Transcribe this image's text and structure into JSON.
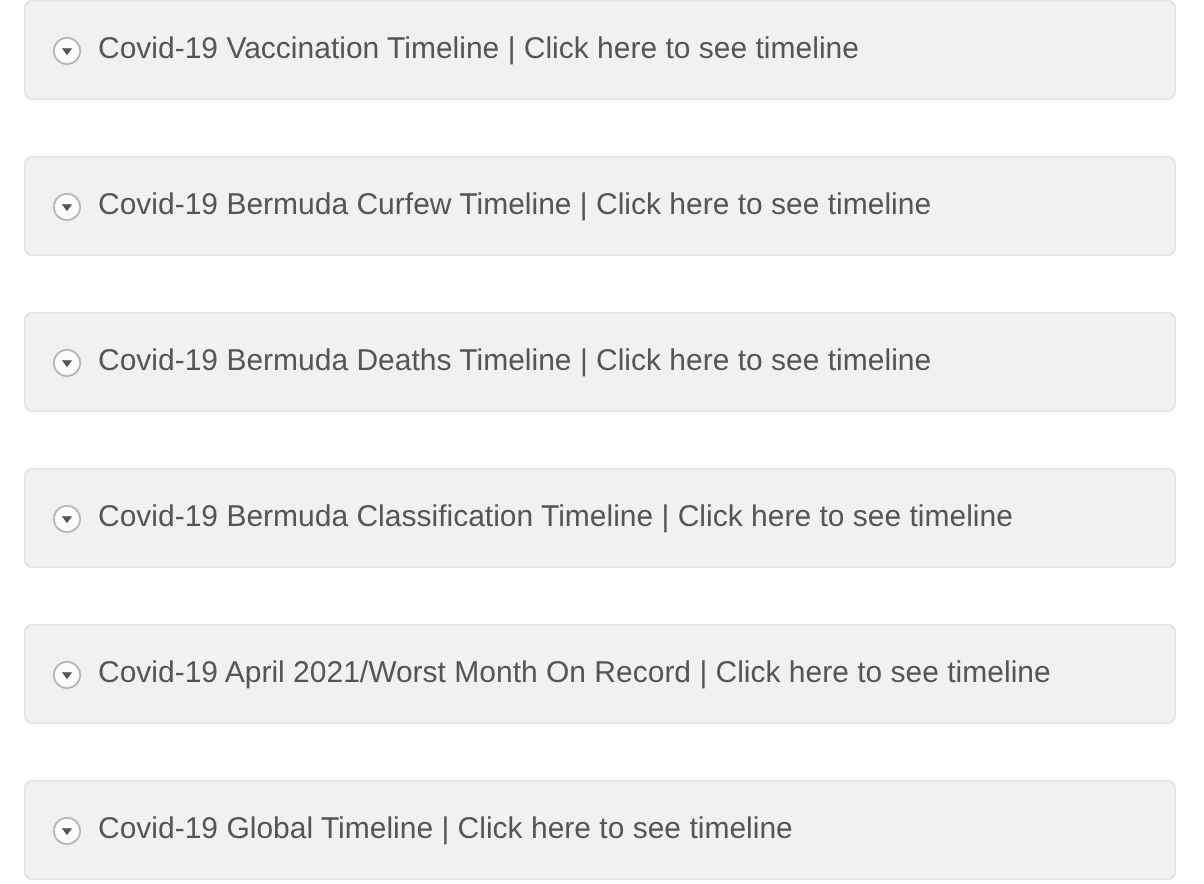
{
  "accordion": [
    {
      "title": "Covid-19 Vaccination Timeline | Click here to see timeline",
      "expanded": false
    },
    {
      "title": "Covid-19 Bermuda Curfew Timeline | Click here to see timeline",
      "expanded": false
    },
    {
      "title": "Covid-19 Bermuda Deaths Timeline | Click here to see timeline",
      "expanded": false
    },
    {
      "title": "Covid-19 Bermuda Classification Timeline | Click here to see timeline",
      "expanded": false
    },
    {
      "title": "Covid-19 April 2021/Worst Month On Record | Click here to see timeline",
      "expanded": false
    },
    {
      "title": "Covid-19 Global Timeline | Click here to see timeline",
      "expanded": false
    }
  ]
}
